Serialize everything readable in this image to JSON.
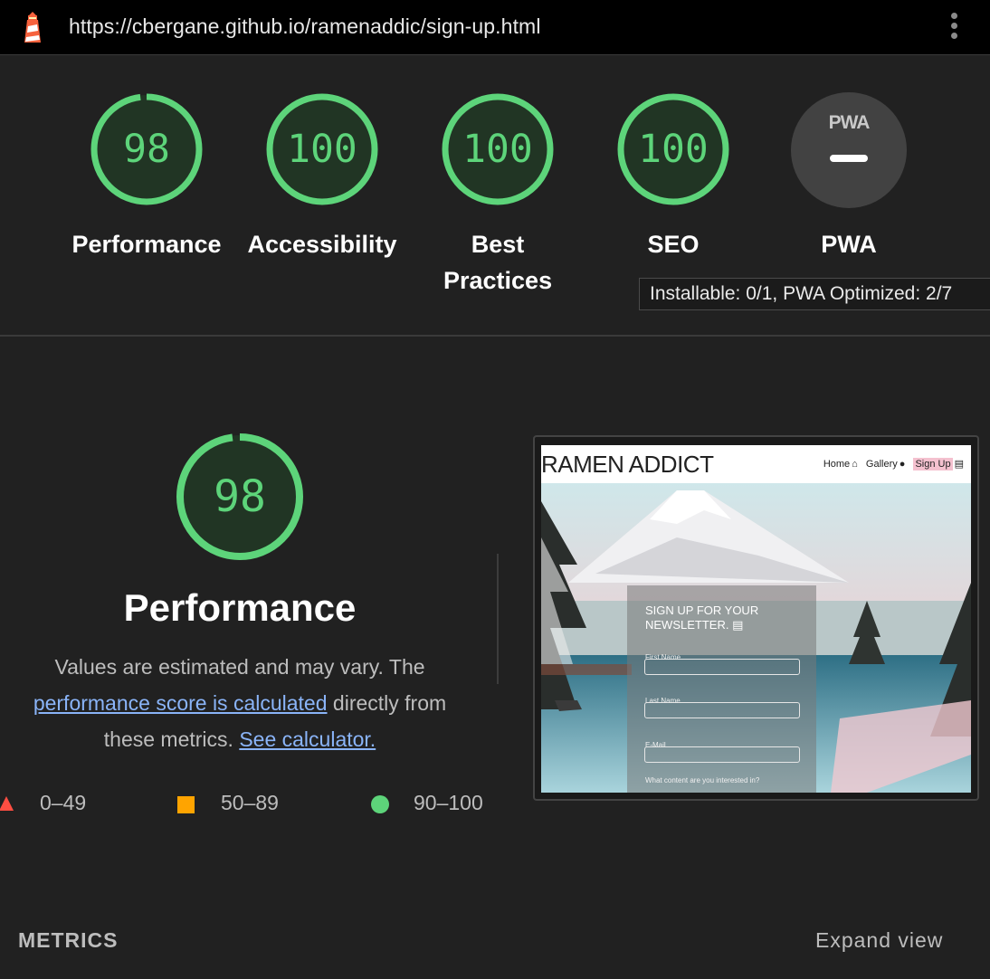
{
  "topbar": {
    "url": "https://cbergane.github.io/ramenaddic/sign-up.html",
    "logo_icon": "lighthouse-icon",
    "menu_icon": "kebab-menu-icon"
  },
  "categories": [
    {
      "score": "98",
      "label": "Performance",
      "fraction": 0.98
    },
    {
      "score": "100",
      "label": "Accessibility",
      "fraction": 1.0
    },
    {
      "score": "100",
      "label": "Best Practices",
      "fraction": 1.0
    },
    {
      "score": "100",
      "label": "SEO",
      "fraction": 1.0
    }
  ],
  "pwa": {
    "badge_text": "PWA",
    "label": "PWA",
    "tooltip": "Installable: 0/1, PWA Optimized: 2/7"
  },
  "performance": {
    "score": "98",
    "fraction": 0.98,
    "title": "Performance",
    "desc_pre": "Values are estimated and may vary. The ",
    "desc_link": "performance score is calculated",
    "desc_mid": " directly from these metrics. ",
    "desc_link2": "See calculator."
  },
  "legend": [
    {
      "range": "0–49",
      "shape": "triangle",
      "color": "#ff4e42"
    },
    {
      "range": "50–89",
      "shape": "square",
      "color": "#ffa400"
    },
    {
      "range": "90–100",
      "shape": "circle",
      "color": "#5dd47a"
    }
  ],
  "screenshot": {
    "brand": "RAMEN ADDICT",
    "nav": [
      "Home",
      "Gallery",
      "Sign Up"
    ],
    "form_title_1": "SIGN UP FOR YOUR",
    "form_title_2": "NEWSLETTER.",
    "fields": [
      "First Name",
      "Last Name",
      "E-Mail"
    ],
    "question": "What content are you interested in?"
  },
  "metrics": {
    "title": "METRICS",
    "expand": "Expand view"
  },
  "colors": {
    "pass": "#5dd47a",
    "link": "#8ab4f8",
    "background": "#212121"
  }
}
